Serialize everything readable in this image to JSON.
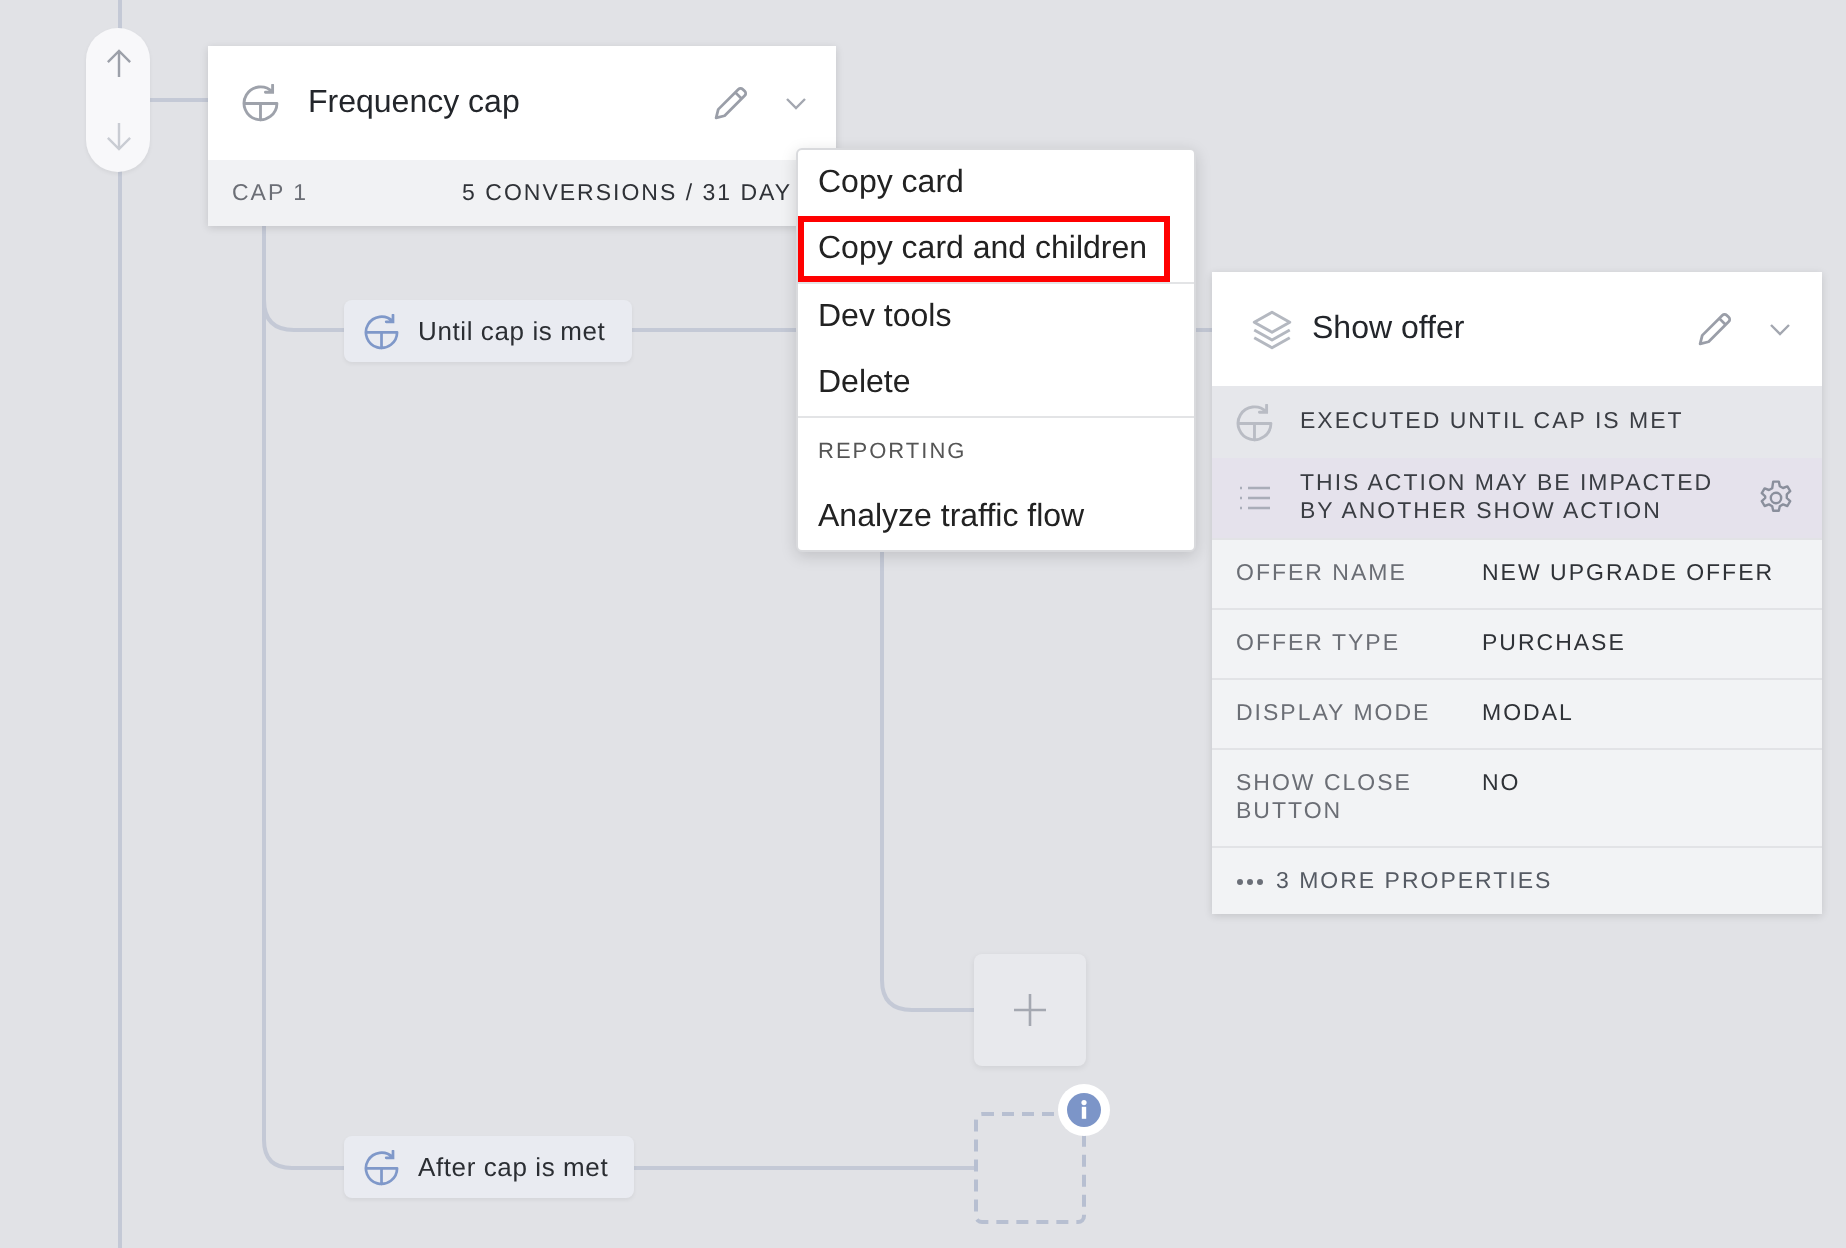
{
  "move_controls": [
    {
      "kind": "up",
      "disabled": false
    },
    {
      "kind": "down",
      "disabled": true
    }
  ],
  "frequency_card": {
    "title": "Frequency cap",
    "cap_label": "CAP 1",
    "cap_value": "5 CONVERSIONS / 31 DAY"
  },
  "branches": [
    {
      "label": "Until cap is met"
    },
    {
      "label": "After cap is met"
    }
  ],
  "show_offer_card": {
    "title": "Show offer",
    "status": "EXECUTED UNTIL CAP IS MET",
    "warning": "THIS ACTION MAY BE IMPACTED BY ANOTHER SHOW ACTION",
    "properties": [
      {
        "name": "OFFER NAME",
        "value": "NEW UPGRADE OFFER"
      },
      {
        "name": "OFFER TYPE",
        "value": "PURCHASE"
      },
      {
        "name": "DISPLAY MODE",
        "value": "MODAL"
      },
      {
        "name": "SHOW CLOSE BUTTON",
        "value": "NO"
      }
    ],
    "more": "3 MORE PROPERTIES"
  },
  "context_menu": {
    "groups": [
      {
        "items": [
          {
            "label": "Copy card",
            "highlighted": false
          },
          {
            "label": "Copy card and children",
            "highlighted": true
          }
        ]
      },
      {
        "items": [
          {
            "label": "Dev tools",
            "highlighted": false
          },
          {
            "label": "Delete",
            "highlighted": false
          }
        ]
      },
      {
        "heading": "REPORTING",
        "items": [
          {
            "label": "Analyze traffic flow",
            "highlighted": false
          }
        ]
      }
    ]
  }
}
